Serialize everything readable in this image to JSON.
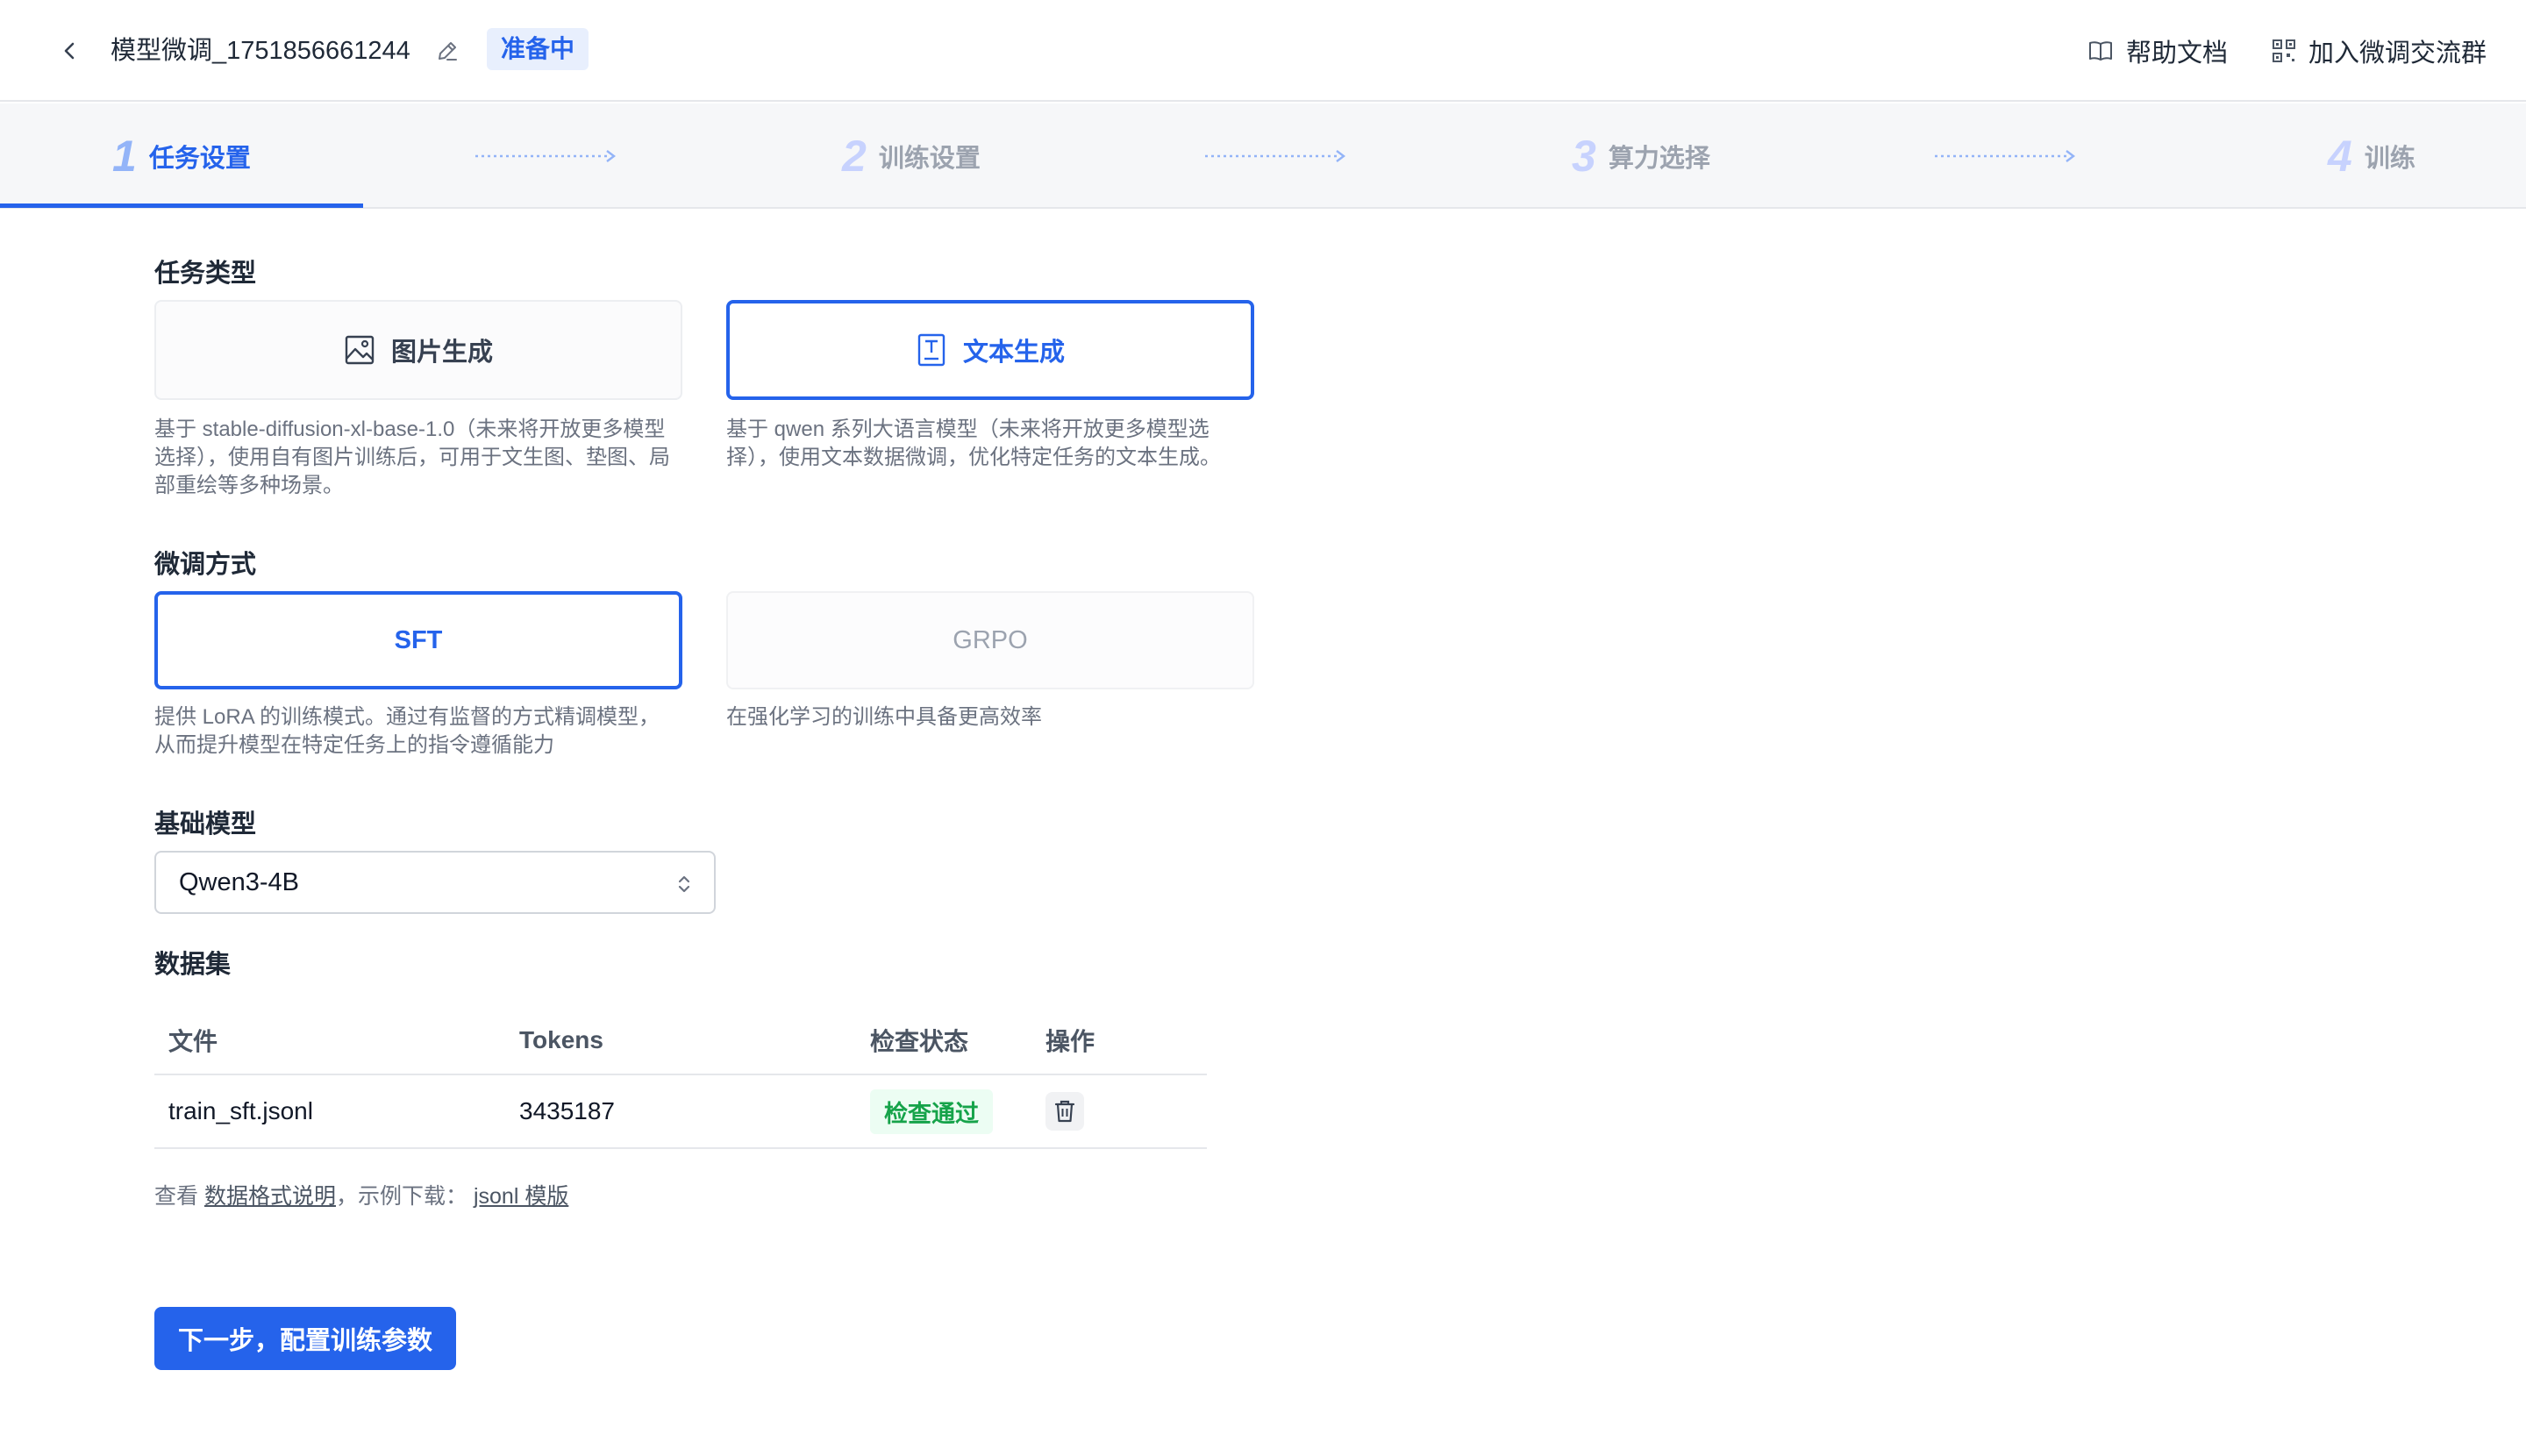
{
  "header": {
    "title": "模型微调_1751856661244",
    "status": "准备中",
    "help_label": "帮助文档",
    "group_label": "加入微调交流群"
  },
  "steps": [
    {
      "num": "1",
      "label": "任务设置",
      "active": true
    },
    {
      "num": "2",
      "label": "训练设置",
      "active": false
    },
    {
      "num": "3",
      "label": "算力选择",
      "active": false
    },
    {
      "num": "4",
      "label": "训练",
      "active": false
    }
  ],
  "task_type": {
    "title": "任务类型",
    "options": [
      {
        "label": "图片生成",
        "icon": "image-icon",
        "selected": false,
        "desc": "基于 stable-diffusion-xl-base-1.0（未来将开放更多模型选择），使用自有图片训练后，可用于文生图、垫图、局部重绘等多种场景。"
      },
      {
        "label": "文本生成",
        "icon": "text-icon",
        "selected": true,
        "desc": "基于 qwen 系列大语言模型（未来将开放更多模型选择），使用文本数据微调，优化特定任务的文本生成。"
      }
    ]
  },
  "finetune_method": {
    "title": "微调方式",
    "options": [
      {
        "label": "SFT",
        "selected": true,
        "desc": "提供 LoRA 的训练模式。通过有监督的方式精调模型，从而提升模型在特定任务上的指令遵循能力"
      },
      {
        "label": "GRPO",
        "selected": false,
        "disabled": true,
        "desc": "在强化学习的训练中具备更高效率"
      }
    ]
  },
  "base_model": {
    "title": "基础模型",
    "value": "Qwen3-4B"
  },
  "dataset": {
    "title": "数据集",
    "columns": [
      "文件",
      "Tokens",
      "检查状态",
      "操作"
    ],
    "rows": [
      {
        "file": "train_sft.jsonl",
        "tokens": "3435187",
        "status": "检查通过"
      }
    ],
    "hint_prefix": "查看",
    "hint_link1": "数据格式说明",
    "hint_mid": "，示例下载：",
    "hint_link2": "jsonl 模版"
  },
  "next_button": "下一步，配置训练参数",
  "colors": {
    "primary": "#2563eb",
    "success": "#16a34a",
    "status_bg": "#e8effd"
  }
}
